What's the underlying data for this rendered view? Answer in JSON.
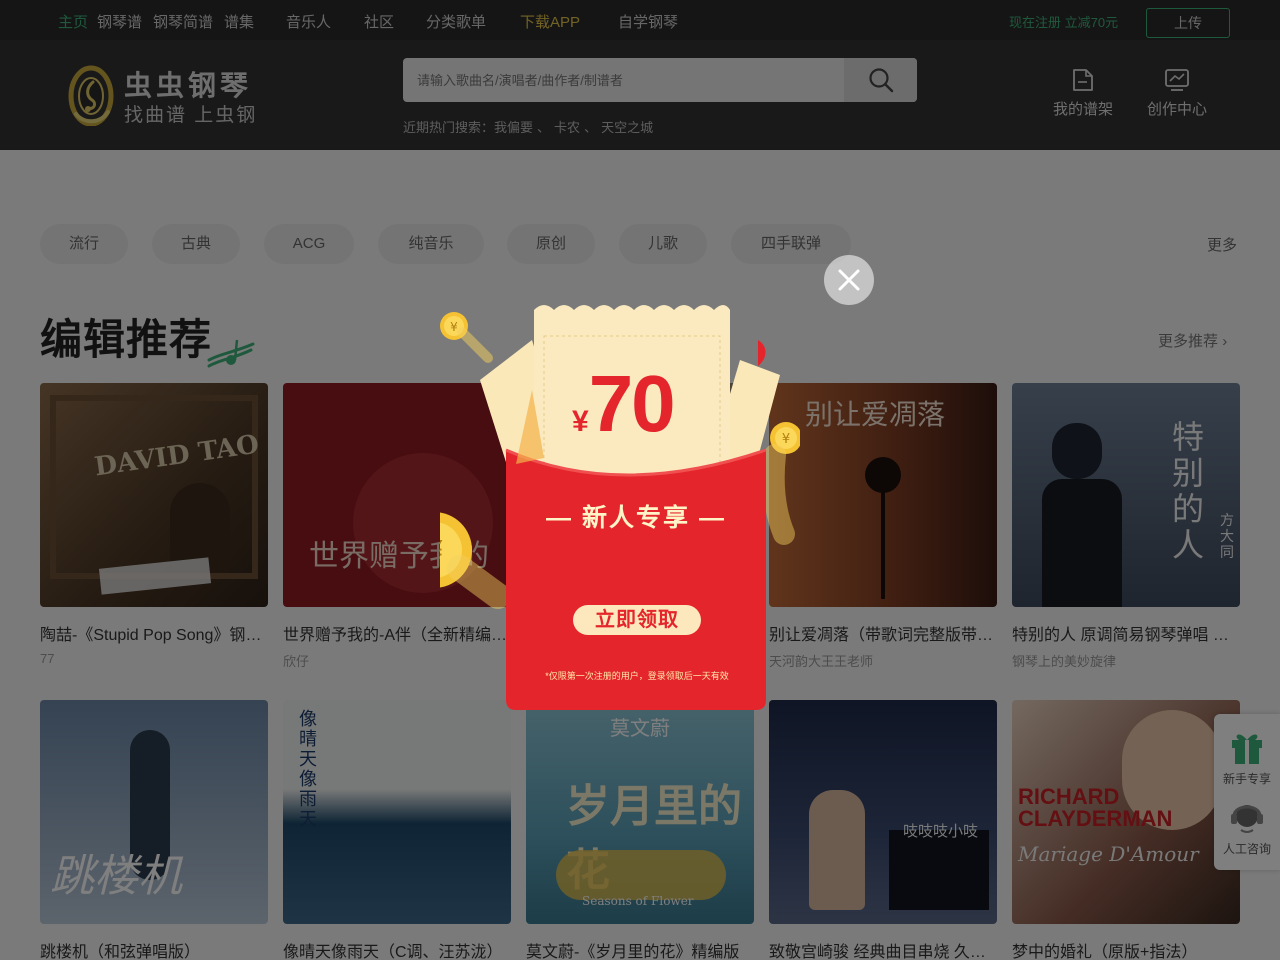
{
  "topnav": {
    "home": "主页",
    "piano_sheet": "钢琴谱",
    "simple_sheet": "钢琴简谱",
    "collection": "谱集",
    "musicians": "音乐人",
    "community": "社区",
    "playlists": "分类歌单",
    "download_app": "下载APP",
    "self_learn": "自学钢琴",
    "promo": "现在注册 立减70元",
    "upload": "上传"
  },
  "header": {
    "logo_name": "虫虫钢琴",
    "logo_slogan": "找曲谱 上虫钢",
    "search_placeholder": "请输入歌曲名/演唱者/曲作者/制谱者",
    "hot_search_label": "近期热门搜索：",
    "hot_searches": [
      "我偏要",
      "卡农",
      "天空之城"
    ],
    "hot_sep": "、",
    "my_shelf": "我的谱架",
    "creator_center": "创作中心"
  },
  "categories": [
    "流行",
    "古典",
    "ACG",
    "纯音乐",
    "原创",
    "儿歌",
    "四手联弹"
  ],
  "categories_more": "更多",
  "section": {
    "title": "编辑推荐",
    "more": "更多推荐"
  },
  "cards": [
    {
      "title": "陶喆-《Stupid Pop Song》钢琴独奏",
      "author": "77",
      "cover_text": "DAVID TAO"
    },
    {
      "title": "世界赠予我的-A伴（全新精编版）",
      "author": "欣仔",
      "cover_text": "世界赠予我的"
    },
    {
      "title": "",
      "author": "",
      "cover_text": ""
    },
    {
      "title": "别让爱凋落（带歌词完整版带和弦）",
      "author": "天河韵大王王老师",
      "cover_text": "别让爱凋落"
    },
    {
      "title": "特别的人 原调简易钢琴弹唱 方大同",
      "author": "钢琴上的美妙旋律",
      "cover_text": "特别的人",
      "cover_sub": "方大同"
    },
    {
      "title": "跳楼机（和弦弹唱版）",
      "author": "",
      "cover_text": "跳楼机"
    },
    {
      "title": "像晴天像雨天（C调、汪苏泷）",
      "author": "",
      "cover_text": "像晴天像雨天"
    },
    {
      "title": "莫文蔚-《岁月里的花》精编版",
      "author": "",
      "cover_text": "岁月里的花",
      "cover_sub": "莫文蔚",
      "cover_en": "Seasons of Flower"
    },
    {
      "title": "致敬宫崎骏 经典曲目串烧 久石让",
      "author": "",
      "cover_text": "吱吱吱小吱"
    },
    {
      "title": "梦中的婚礼（原版+指法）",
      "author": "",
      "cover_text": "RICHARD CLAYDERMAN",
      "cover_sub": "Mariage D'Amour"
    }
  ],
  "side_float": {
    "newbie": "新手专享",
    "service": "人工咨询"
  },
  "modal": {
    "currency": "¥",
    "amount": "70",
    "title": "— 新人专享 —",
    "claim": "立即领取",
    "note": "*仅限第一次注册的用户，登录领取后一天有效"
  },
  "colors": {
    "accent_green": "#3fb37a",
    "app_yellow": "#e6c44a",
    "redpack_red": "#e4262c"
  }
}
